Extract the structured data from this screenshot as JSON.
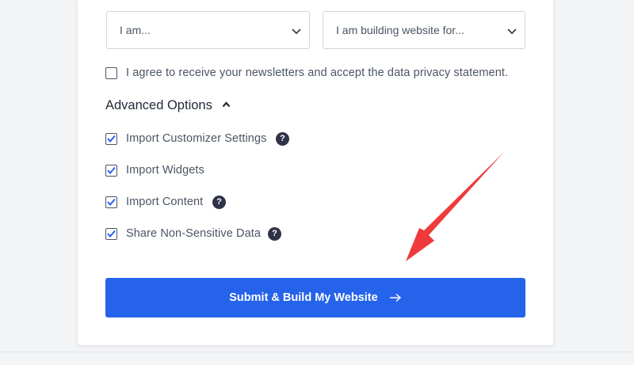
{
  "form": {
    "role_select": {
      "value": "I am..."
    },
    "purpose_select": {
      "value": "I am building website for..."
    },
    "newsletter": {
      "label": "I agree to receive your newsletters and accept the data privacy statement.",
      "checked": false
    },
    "advanced": {
      "title": "Advanced Options",
      "expanded": true,
      "options": [
        {
          "label": "Import Customizer Settings",
          "checked": true,
          "help": true
        },
        {
          "label": "Import Widgets",
          "checked": true,
          "help": false
        },
        {
          "label": "Import Content",
          "checked": true,
          "help": true
        },
        {
          "label": "Share Non-Sensitive Data",
          "checked": true,
          "help": true
        }
      ]
    },
    "help_glyph": "?",
    "submit_label": "Submit & Build My Website"
  },
  "icons": {
    "select_chevron": "chevron-down-icon",
    "advanced_toggle": "caret-up-icon",
    "checkbox_check": "checkmark-icon",
    "help": "question-circle-icon",
    "submit_arrow": "arrow-right-icon",
    "annotation": "red-arrow-annotation"
  },
  "colors": {
    "accent": "#2563eb",
    "help_bg": "#2f3349",
    "check": "#2563eb",
    "annotation_red": "#ef3b3b"
  }
}
